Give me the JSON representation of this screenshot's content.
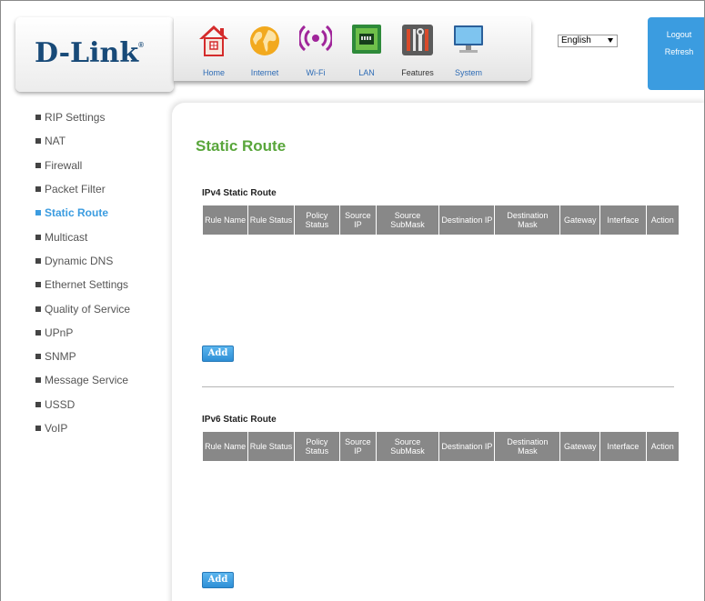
{
  "brand": {
    "logo_text": "D-Link",
    "logo_mark": "®"
  },
  "nav": {
    "items": [
      {
        "label": "Home",
        "icon": "home-icon"
      },
      {
        "label": "Internet",
        "icon": "globe-icon"
      },
      {
        "label": "Wi-Fi",
        "icon": "wifi-icon"
      },
      {
        "label": "LAN",
        "icon": "lan-icon"
      },
      {
        "label": "Features",
        "icon": "tools-icon"
      },
      {
        "label": "System",
        "icon": "monitor-icon"
      }
    ]
  },
  "language": {
    "selected": "English"
  },
  "session": {
    "logout_label": "Logout",
    "refresh_label": "Refresh"
  },
  "sidebar": {
    "items": [
      {
        "label": "RIP Settings"
      },
      {
        "label": "NAT"
      },
      {
        "label": "Firewall"
      },
      {
        "label": "Packet Filter"
      },
      {
        "label": "Static Route",
        "active": true
      },
      {
        "label": "Multicast"
      },
      {
        "label": "Dynamic DNS"
      },
      {
        "label": "Ethernet Settings"
      },
      {
        "label": "Quality of Service"
      },
      {
        "label": "UPnP"
      },
      {
        "label": "SNMP"
      },
      {
        "label": "Message Service"
      },
      {
        "label": "USSD"
      },
      {
        "label": "VoIP"
      }
    ]
  },
  "main": {
    "title": "Static Route",
    "ipv4": {
      "title": "IPv4 Static Route",
      "columns": [
        "Rule Name",
        "Rule Status",
        "Policy Status",
        "Source IP",
        "Source SubMask",
        "Destination IP",
        "Destination Mask",
        "Gateway",
        "Interface",
        "Action"
      ],
      "add_label": "Add"
    },
    "ipv6": {
      "title": "IPv6 Static Route",
      "columns": [
        "Rule Name",
        "Rule Status",
        "Policy Status",
        "Source IP",
        "Source SubMask",
        "Destination IP",
        "Destination Mask",
        "Gateway",
        "Interface",
        "Action"
      ],
      "add_label": "Add"
    }
  },
  "colors": {
    "accent_blue": "#3b9ce0",
    "title_green": "#59a63b",
    "header_gray": "#888888",
    "brand_navy": "#184a78"
  }
}
